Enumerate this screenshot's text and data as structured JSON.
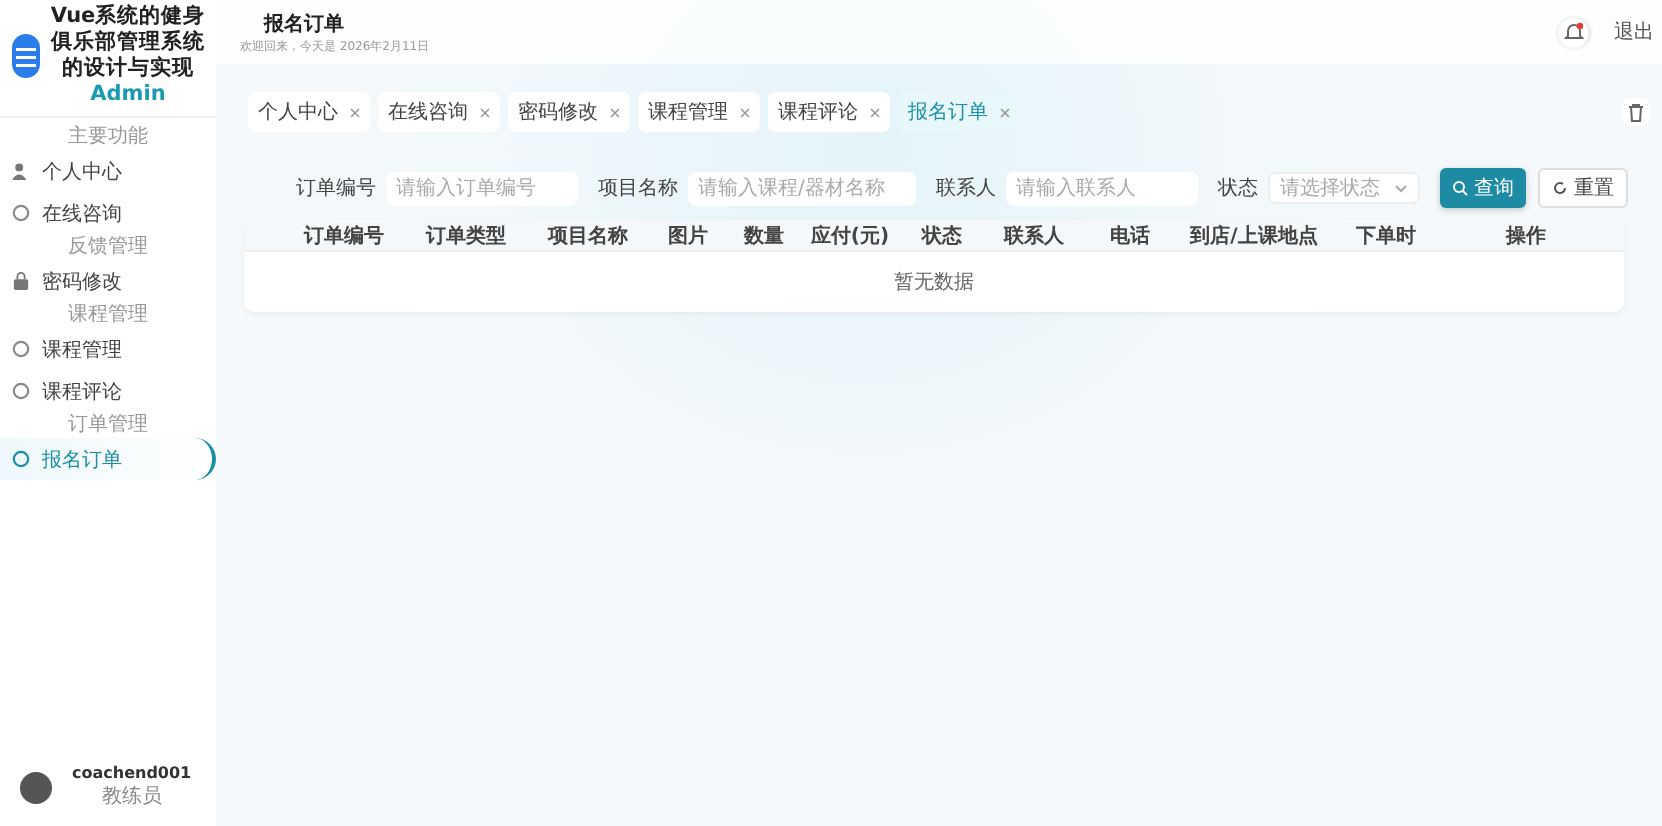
{
  "sidebar": {
    "title": "Vue系统的健身俱乐部管理系统的设计与实现",
    "title_accent": "Admin",
    "items": [
      {
        "kind": "section",
        "label": "主要功能"
      },
      {
        "kind": "person",
        "label": "个人中心",
        "selected": false
      },
      {
        "kind": "circle",
        "label": "在线咨询",
        "selected": false
      },
      {
        "kind": "section",
        "label": "反馈管理"
      },
      {
        "kind": "lock",
        "label": "密码修改",
        "selected": false
      },
      {
        "kind": "section",
        "label": "课程管理"
      },
      {
        "kind": "circle",
        "label": "课程管理",
        "selected": false
      },
      {
        "kind": "circle",
        "label": "课程评论",
        "selected": false
      },
      {
        "kind": "section",
        "label": "订单管理"
      },
      {
        "kind": "circle",
        "label": "报名订单",
        "selected": true
      }
    ],
    "user": {
      "name": "coachend001",
      "role": "教练员"
    }
  },
  "header": {
    "title": "报名订单",
    "subtitle": "欢迎回来，今天是 2026年2月11日",
    "notification": true,
    "logout": "退出"
  },
  "tabs": [
    {
      "label": "个人中心",
      "selected": false
    },
    {
      "label": "在线咨询",
      "selected": false
    },
    {
      "label": "密码修改",
      "selected": false
    },
    {
      "label": "课程管理",
      "selected": false
    },
    {
      "label": "课程评论",
      "selected": false
    },
    {
      "label": "报名订单",
      "selected": true
    }
  ],
  "filters": [
    {
      "kind": "input",
      "label": "订单编号",
      "placeholder": "请输入订单编号"
    },
    {
      "kind": "input",
      "label": "项目名称",
      "placeholder": "请输入课程/器材名称"
    },
    {
      "kind": "input",
      "label": "联系人",
      "placeholder": "请输入联系人"
    },
    {
      "kind": "select",
      "label": "状态",
      "placeholder": "请选择状态"
    }
  ],
  "buttons": [
    {
      "kind": "primary",
      "label": "查询"
    },
    {
      "kind": "plain",
      "label": "重置"
    }
  ],
  "table": {
    "columns": [
      "订单编号",
      "订单类型",
      "项目名称",
      "图片",
      "数量",
      "应付(元)",
      "状态",
      "联系人",
      "电话",
      "到店/上课地点",
      "下单时",
      "操作"
    ],
    "empty_text": "暂无数据"
  }
}
